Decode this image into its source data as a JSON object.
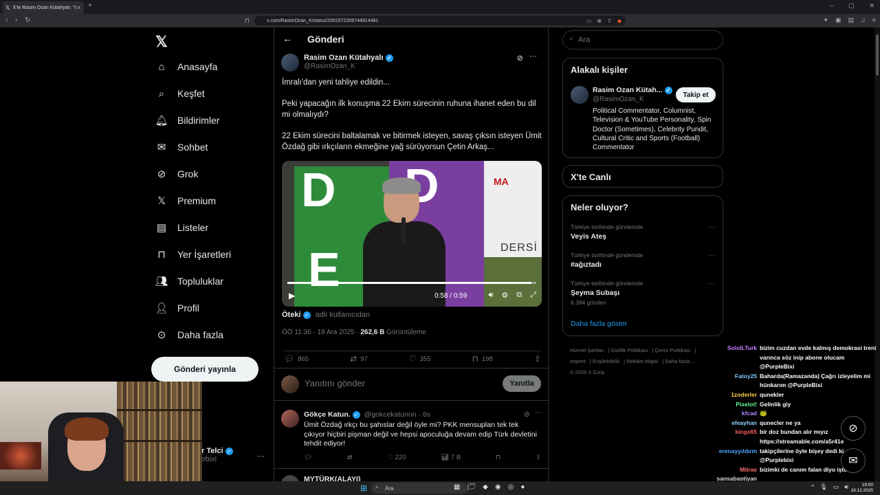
{
  "browser": {
    "tab_title": "X'te Rasim Ozan Kütahyalı: \"İmralı'",
    "url": "x.com/RasimOzan_K/status/2001572309744914481"
  },
  "nav": {
    "items": [
      {
        "label": "Anasayfa",
        "icon": "home-icon"
      },
      {
        "label": "Keşfet",
        "icon": "search-icon"
      },
      {
        "label": "Bildirimler",
        "icon": "bell-icon"
      },
      {
        "label": "Sohbet",
        "icon": "mail-icon"
      },
      {
        "label": "Grok",
        "icon": "grok-icon"
      },
      {
        "label": "Premium",
        "icon": "x-premium-icon"
      },
      {
        "label": "Listeler",
        "icon": "list-icon"
      },
      {
        "label": "Yer İşaretleri",
        "icon": "bookmark-icon"
      },
      {
        "label": "Topluluklar",
        "icon": "communities-icon"
      },
      {
        "label": "Profil",
        "icon": "person-icon"
      },
      {
        "label": "Daha fazla",
        "icon": "more-circle-icon"
      }
    ],
    "post_button": "Gönderi yayınla",
    "account_name": "ır Telci",
    "account_handle": "lebixi"
  },
  "header": {
    "title": "Gönderi"
  },
  "post": {
    "author_name": "Rasim Ozan Kütahyalı",
    "author_handle": "@RasimOzan_K",
    "paragraphs": [
      "İmralı'dan yeni tahliye edildin...",
      "Peki yapacağın ilk konuşma 22 Ekim sürecinin ruhuna ihanet eden bu dil mi olmalıydı?",
      "22 Ekim sürecini baltalamak ve bitirmek isteyen, savaş çıksın isteyen Ümit Özdağ gibi ırkçıların ekmeğine yağ sürüyorsun Çetin Arkaş..."
    ],
    "video": {
      "time": "0:58 / 0:59",
      "progress": 0.98,
      "banner_logo": "MA",
      "banner_text": "DERSİ"
    },
    "source_name": "Öteki",
    "source_via": "adlı kullanıcıdan",
    "timestamp": "ÖÖ 11:36 · 18 Ara 2025 ·",
    "views": "262,6 B",
    "views_label": "Görüntüleme",
    "stats": {
      "replies": "865",
      "reposts": "97",
      "likes": "355",
      "bookmarks": "198"
    }
  },
  "reply_box": {
    "placeholder": "Yanıtını gönder",
    "button": "Yanıtla"
  },
  "replies": [
    {
      "name": "Gökçe Katun.",
      "handle": "@gokcekatunnn · 6s",
      "text": "Ümit Özdağ ırkçı bu şahıslar değil öyle mi? PKK mensupları tek tek çıkıyor hiçbiri pişman değil ve hepsi apoculuğa devam edip Türk devletini tehdit ediyor!",
      "likes": "220",
      "views": "7 B"
    }
  ],
  "reply2": {
    "name": "MYTÜRK(ALAYI)"
  },
  "search": {
    "placeholder": "Ara"
  },
  "related": {
    "title": "Alakalı kişiler",
    "name": "Rasim Ozan Kütah...",
    "handle": "@RasimOzan_K",
    "follow": "Takip et",
    "bio": "Political Commentator, Columnist, Television & YouTube Personality, Spin Doctor (Sometimes), Celebrity Pundit, Cultural Critic and Sports (Football) Commentator"
  },
  "live": {
    "title": "X'te Canlı"
  },
  "trends": {
    "title": "Neler oluyor?",
    "items": [
      {
        "context": "Türkiye tarihinde gündemde",
        "topic": "Veyis Ateş",
        "count": ""
      },
      {
        "context": "Türkiye tarihinde gündemde",
        "topic": "#ağıztadı",
        "count": ""
      },
      {
        "context": "Türkiye tarihinde gündemde",
        "topic": "Şeyma Subaşı",
        "count": "6.384 gönderi"
      }
    ],
    "show_more": "Daha fazla göster"
  },
  "footer": {
    "links": [
      "Hizmet Şartları",
      "Gizlilik Politikası",
      "Çerez Politikası",
      "Imprint",
      "Erişilebilirlik",
      "Reklam bilgisi",
      "Daha fazla ..."
    ],
    "copyright": "© 2025 X Corp."
  },
  "chat": [
    {
      "user": "SoloILTurk",
      "color": "#c77dff",
      "msg": "bizim cuzdan evde kalmış demokrasi treni varınca söz inip abone olucam @PurpleBixi"
    },
    {
      "user": "Fatoy25",
      "color": "#7ec8ff",
      "msg": "Baharda(Ramazanda) Çağrı izleyelim mi hünkarım @PurpleBixi"
    },
    {
      "user": "1zoderler",
      "color": "#ffd24d",
      "msg": "qunekler"
    },
    {
      "user": "Pixelot!",
      "color": "#66ff99",
      "msg": "Gelinlik giy"
    },
    {
      "user": "kfcad",
      "color": "#b388ff",
      "msg": "🐸"
    },
    {
      "user": "efeayhan",
      "color": "#8fd3ff",
      "msg": "qunecler ne ya"
    },
    {
      "user": "kingx65",
      "color": "#ff5c5c",
      "msg": "bir doz bundan alır mıyız https://streamable.com/a5r41e"
    },
    {
      "user": "erenayyıldırm",
      "color": "#4da6ff",
      "msg": "takipçilerine öyle bişey dedi ki @Purplebixi"
    },
    {
      "user": "Mitrae",
      "color": "#ff6f6f",
      "msg": "bizimki de canım falan diyo işte"
    },
    {
      "user": "sansabastiyan",
      "color": "#dddddd",
      "msg": ""
    }
  ],
  "taskbar": {
    "search": "Ara",
    "time": "19:00",
    "date": "18.12.2025"
  },
  "colors": {
    "accent": "#1d9bf0",
    "background": "#000000",
    "border": "#2f3336",
    "muted": "#71767b"
  }
}
